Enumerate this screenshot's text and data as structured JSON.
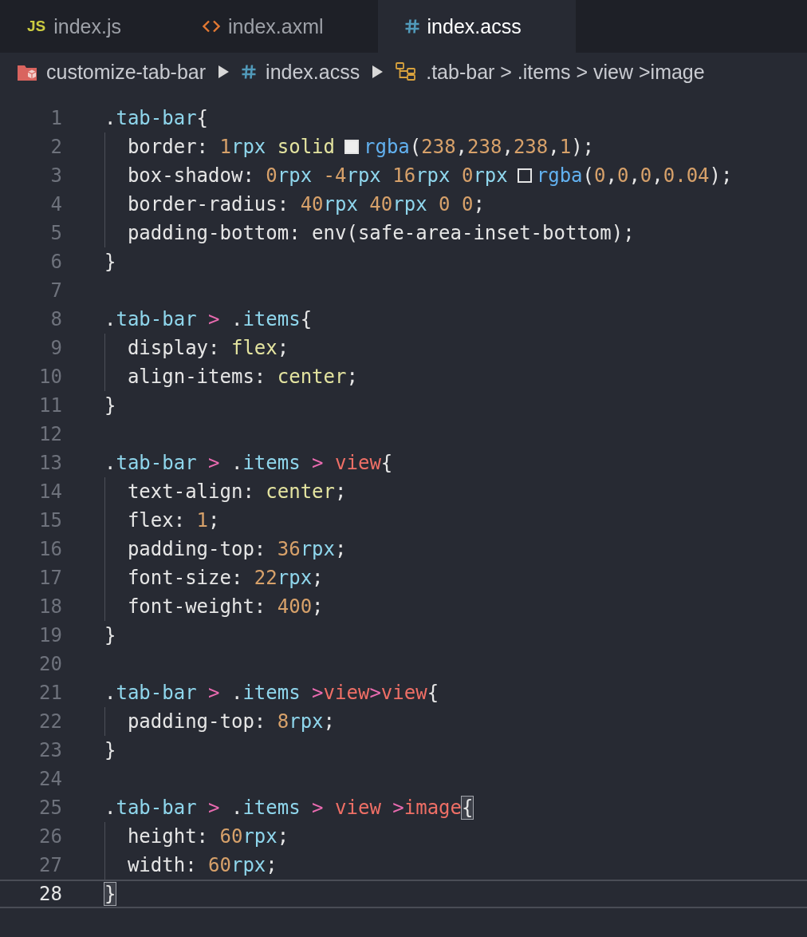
{
  "tabs": [
    {
      "kind": "js",
      "badge": "JS",
      "label": "index.js",
      "selected": false
    },
    {
      "kind": "xml",
      "label": "index.axml",
      "selected": false
    },
    {
      "kind": "css",
      "label": "index.acss",
      "selected": true
    }
  ],
  "breadcrumb": [
    {
      "kind": "folder",
      "label": "customize-tab-bar"
    },
    {
      "kind": "css",
      "label": "index.acss"
    },
    {
      "kind": "symbol",
      "label": ".tab-bar > .items > view >image"
    }
  ],
  "editor": {
    "lines": [
      {
        "number": "1",
        "current": false,
        "tokens": [
          {
            "text": ".",
            "kind": "punct"
          },
          {
            "text": "tab-bar",
            "kind": "class"
          },
          {
            "text": "{",
            "kind": "punct"
          }
        ],
        "children": [
          {
            "number": "2",
            "current": false,
            "tokens": [
              {
                "text": "border",
                "kind": "property"
              },
              {
                "text": ": ",
                "kind": "punct"
              },
              {
                "text": "1",
                "kind": "number"
              },
              {
                "text": "rpx ",
                "kind": "unit"
              },
              {
                "text": "solid",
                "kind": "keyword"
              },
              {
                "kind": "swatch",
                "filled": true
              },
              {
                "text": "rgba",
                "kind": "function"
              },
              {
                "text": "(",
                "kind": "punct"
              },
              {
                "text": "238",
                "kind": "number"
              },
              {
                "text": ",",
                "kind": "punct"
              },
              {
                "text": "238",
                "kind": "number"
              },
              {
                "text": ",",
                "kind": "punct"
              },
              {
                "text": "238",
                "kind": "number"
              },
              {
                "text": ",",
                "kind": "punct"
              },
              {
                "text": "1",
                "kind": "number"
              },
              {
                "text": ");",
                "kind": "punct"
              }
            ]
          },
          {
            "number": "3",
            "current": false,
            "tokens": [
              {
                "text": "box-shadow",
                "kind": "property"
              },
              {
                "text": ": ",
                "kind": "punct"
              },
              {
                "text": "0",
                "kind": "number"
              },
              {
                "text": "rpx ",
                "kind": "unit"
              },
              {
                "text": "-4",
                "kind": "number"
              },
              {
                "text": "rpx ",
                "kind": "unit"
              },
              {
                "text": "16",
                "kind": "number"
              },
              {
                "text": "rpx ",
                "kind": "unit"
              },
              {
                "text": "0",
                "kind": "number"
              },
              {
                "text": "rpx",
                "kind": "unit"
              },
              {
                "kind": "swatch",
                "filled": false
              },
              {
                "text": "rgba",
                "kind": "function"
              },
              {
                "text": "(",
                "kind": "punct"
              },
              {
                "text": "0",
                "kind": "number"
              },
              {
                "text": ",",
                "kind": "punct"
              },
              {
                "text": "0",
                "kind": "number"
              },
              {
                "text": ",",
                "kind": "punct"
              },
              {
                "text": "0",
                "kind": "number"
              },
              {
                "text": ",",
                "kind": "punct"
              },
              {
                "text": "0.04",
                "kind": "number"
              },
              {
                "text": ");",
                "kind": "punct"
              }
            ]
          },
          {
            "number": "4",
            "current": false,
            "tokens": [
              {
                "text": "border-radius",
                "kind": "property"
              },
              {
                "text": ": ",
                "kind": "punct"
              },
              {
                "text": "40",
                "kind": "number"
              },
              {
                "text": "rpx ",
                "kind": "unit"
              },
              {
                "text": "40",
                "kind": "number"
              },
              {
                "text": "rpx ",
                "kind": "unit"
              },
              {
                "text": "0 0",
                "kind": "number"
              },
              {
                "text": ";",
                "kind": "punct"
              }
            ]
          },
          {
            "number": "5",
            "current": false,
            "tokens": [
              {
                "text": "padding-bottom",
                "kind": "property"
              },
              {
                "text": ": env(safe-area-inset-bottom);",
                "kind": "punct"
              }
            ]
          }
        ]
      },
      {
        "number": "6",
        "current": false,
        "tokens": [
          {
            "text": "}",
            "kind": "punct"
          }
        ]
      },
      {
        "number": "7",
        "current": false
      },
      {
        "number": "8",
        "current": false,
        "tokens": [
          {
            "text": ".",
            "kind": "punct"
          },
          {
            "text": "tab-bar",
            "kind": "class"
          },
          {
            "text": " >",
            "kind": "combinator"
          },
          {
            "text": " .",
            "kind": "punct"
          },
          {
            "text": "items",
            "kind": "class"
          },
          {
            "text": "{",
            "kind": "punct"
          }
        ],
        "children": [
          {
            "number": "9",
            "current": false,
            "tokens": [
              {
                "text": "display",
                "kind": "property"
              },
              {
                "text": ": ",
                "kind": "punct"
              },
              {
                "text": "flex",
                "kind": "keyword"
              },
              {
                "text": ";",
                "kind": "punct"
              }
            ]
          },
          {
            "number": "10",
            "current": false,
            "tokens": [
              {
                "text": "align-items",
                "kind": "property"
              },
              {
                "text": ": ",
                "kind": "punct"
              },
              {
                "text": "center",
                "kind": "keyword"
              },
              {
                "text": ";",
                "kind": "punct"
              }
            ]
          }
        ]
      },
      {
        "number": "11",
        "current": false,
        "tokens": [
          {
            "text": "}",
            "kind": "punct"
          }
        ]
      },
      {
        "number": "12",
        "current": false
      },
      {
        "number": "13",
        "current": false,
        "tokens": [
          {
            "text": ".",
            "kind": "punct"
          },
          {
            "text": "tab-bar",
            "kind": "class"
          },
          {
            "text": " >",
            "kind": "combinator"
          },
          {
            "text": " .",
            "kind": "punct"
          },
          {
            "text": "items",
            "kind": "class"
          },
          {
            "text": " >",
            "kind": "combinator"
          },
          {
            "text": " view",
            "kind": "tag"
          },
          {
            "text": "{",
            "kind": "punct"
          }
        ],
        "children": [
          {
            "number": "14",
            "current": false,
            "tokens": [
              {
                "text": "text-align",
                "kind": "property"
              },
              {
                "text": ": ",
                "kind": "punct"
              },
              {
                "text": "center",
                "kind": "keyword"
              },
              {
                "text": ";",
                "kind": "punct"
              }
            ]
          },
          {
            "number": "15",
            "current": false,
            "tokens": [
              {
                "text": "flex",
                "kind": "property"
              },
              {
                "text": ": ",
                "kind": "punct"
              },
              {
                "text": "1",
                "kind": "number"
              },
              {
                "text": ";",
                "kind": "punct"
              }
            ]
          },
          {
            "number": "16",
            "current": false,
            "tokens": [
              {
                "text": "padding-top",
                "kind": "property"
              },
              {
                "text": ": ",
                "kind": "punct"
              },
              {
                "text": "36",
                "kind": "number"
              },
              {
                "text": "rpx",
                "kind": "unit"
              },
              {
                "text": ";",
                "kind": "punct"
              }
            ]
          },
          {
            "number": "17",
            "current": false,
            "tokens": [
              {
                "text": "font-size",
                "kind": "property"
              },
              {
                "text": ": ",
                "kind": "punct"
              },
              {
                "text": "22",
                "kind": "number"
              },
              {
                "text": "rpx",
                "kind": "unit"
              },
              {
                "text": ";",
                "kind": "punct"
              }
            ]
          },
          {
            "number": "18",
            "current": false,
            "tokens": [
              {
                "text": "font-weight",
                "kind": "property"
              },
              {
                "text": ": ",
                "kind": "punct"
              },
              {
                "text": "400",
                "kind": "number"
              },
              {
                "text": ";",
                "kind": "punct"
              }
            ]
          }
        ]
      },
      {
        "number": "19",
        "current": false,
        "tokens": [
          {
            "text": "}",
            "kind": "punct"
          }
        ]
      },
      {
        "number": "20",
        "current": false
      },
      {
        "number": "21",
        "current": false,
        "tokens": [
          {
            "text": ".",
            "kind": "punct"
          },
          {
            "text": "tab-bar",
            "kind": "class"
          },
          {
            "text": " >",
            "kind": "combinator"
          },
          {
            "text": " .",
            "kind": "punct"
          },
          {
            "text": "items",
            "kind": "class"
          },
          {
            "text": " >",
            "kind": "combinator"
          },
          {
            "text": "view",
            "kind": "tag"
          },
          {
            "text": ">",
            "kind": "combinator"
          },
          {
            "text": "view",
            "kind": "tag"
          },
          {
            "text": "{",
            "kind": "punct"
          }
        ],
        "children": [
          {
            "number": "22",
            "current": false,
            "tokens": [
              {
                "text": "padding-top",
                "kind": "property"
              },
              {
                "text": ": ",
                "kind": "punct"
              },
              {
                "text": "8",
                "kind": "number"
              },
              {
                "text": "rpx",
                "kind": "unit"
              },
              {
                "text": ";",
                "kind": "punct"
              }
            ]
          }
        ]
      },
      {
        "number": "23",
        "current": false,
        "tokens": [
          {
            "text": "}",
            "kind": "punct"
          }
        ]
      },
      {
        "number": "24",
        "current": false
      },
      {
        "number": "25",
        "current": false,
        "tokens": [
          {
            "text": ".",
            "kind": "punct"
          },
          {
            "text": "tab-bar",
            "kind": "class"
          },
          {
            "text": " >",
            "kind": "combinator"
          },
          {
            "text": " .",
            "kind": "punct"
          },
          {
            "text": "items",
            "kind": "class"
          },
          {
            "text": " >",
            "kind": "combinator"
          },
          {
            "text": " view",
            "kind": "tag"
          },
          {
            "text": " >",
            "kind": "combinator"
          },
          {
            "text": "image",
            "kind": "tag"
          },
          {
            "text": "{",
            "kind": "brace-match"
          }
        ],
        "children": [
          {
            "number": "26",
            "current": false,
            "tokens": [
              {
                "text": "height",
                "kind": "property"
              },
              {
                "text": ": ",
                "kind": "punct"
              },
              {
                "text": "60",
                "kind": "number"
              },
              {
                "text": "rpx",
                "kind": "unit"
              },
              {
                "text": ";",
                "kind": "punct"
              }
            ]
          },
          {
            "number": "27",
            "current": false,
            "tokens": [
              {
                "text": "width",
                "kind": "property"
              },
              {
                "text": ": ",
                "kind": "punct"
              },
              {
                "text": "60",
                "kind": "number"
              },
              {
                "text": "rpx",
                "kind": "unit"
              },
              {
                "text": ";",
                "kind": "punct"
              }
            ]
          }
        ]
      },
      {
        "number": "28",
        "current": true,
        "tokens": [
          {
            "text": "}",
            "kind": "brace-match"
          }
        ]
      }
    ]
  }
}
